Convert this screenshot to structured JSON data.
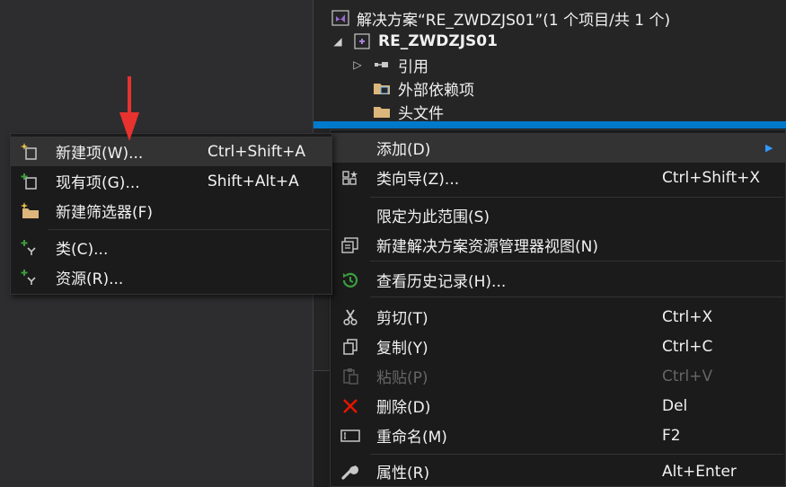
{
  "solution_explorer": {
    "solution_label": "解决方案“RE_ZWDZJS01”(1 个项目/共 1 个)",
    "project_label": "RE_ZWDZJS01",
    "items": [
      {
        "label": "引用"
      },
      {
        "label": "外部依赖项"
      },
      {
        "label": "头文件"
      }
    ]
  },
  "context_menu": {
    "add_label": "添加(D)",
    "class_wizard_label": "类向导(Z)...",
    "class_wizard_shortcut": "Ctrl+Shift+X",
    "scope_label": "限定为此范围(S)",
    "new_view_label": "新建解决方案资源管理器视图(N)",
    "history_label": "查看历史记录(H)...",
    "cut_label": "剪切(T)",
    "cut_shortcut": "Ctrl+X",
    "copy_label": "复制(Y)",
    "copy_shortcut": "Ctrl+C",
    "paste_label": "粘贴(P)",
    "paste_shortcut": "Ctrl+V",
    "delete_label": "删除(D)",
    "delete_shortcut": "Del",
    "rename_label": "重命名(M)",
    "rename_shortcut": "F2",
    "properties_label": "属性(R)",
    "properties_shortcut": "Alt+Enter"
  },
  "add_submenu": {
    "new_item_label": "新建项(W)...",
    "new_item_shortcut": "Ctrl+Shift+A",
    "existing_item_label": "现有项(G)...",
    "existing_item_shortcut": "Shift+Alt+A",
    "new_filter_label": "新建筛选器(F)",
    "class_label": "类(C)...",
    "resource_label": "资源(R)..."
  },
  "colors": {
    "accent": "#007acc",
    "delete_icon": "#e51400",
    "folder": "#dcb67a",
    "history_icon": "#3c9e3c",
    "arrow": "#e8322e"
  }
}
